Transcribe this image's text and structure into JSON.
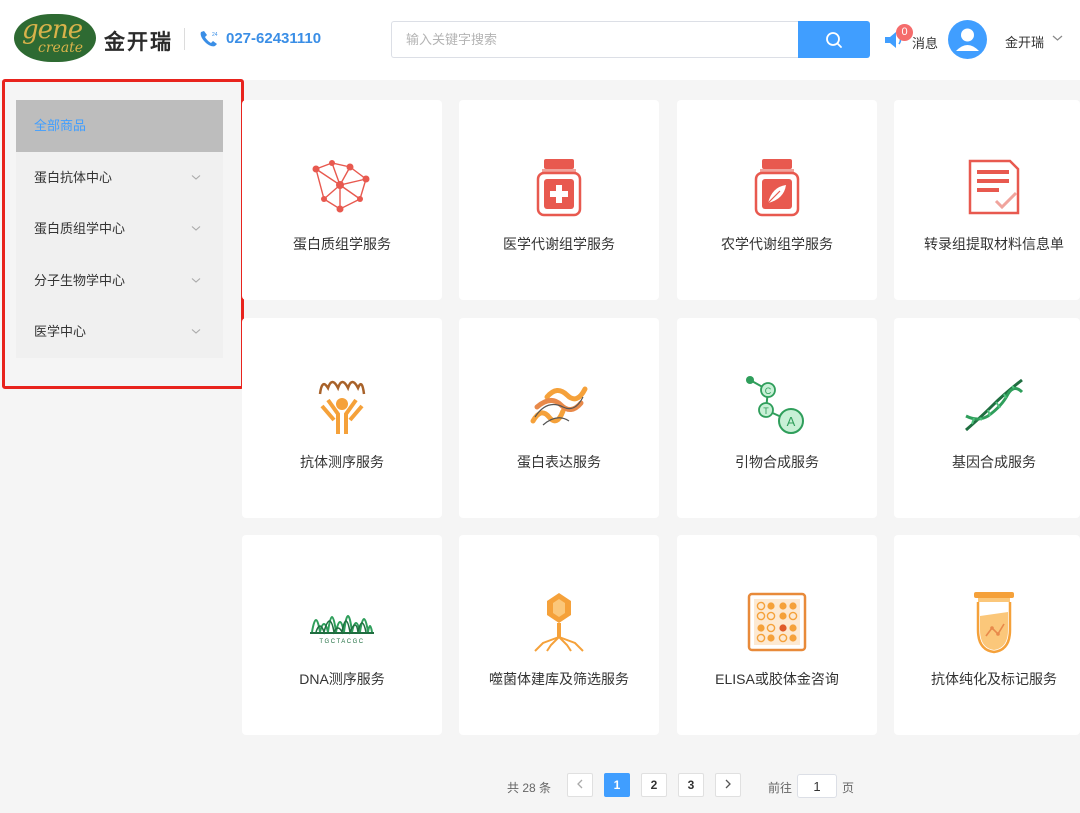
{
  "header": {
    "logo_word_top": "gene",
    "logo_word_bottom": "create",
    "brand": "金开瑞",
    "phone": "027-62431110",
    "search_placeholder": "输入关键字搜索",
    "message_count": "0",
    "message_label": "消息",
    "username": "金开瑞"
  },
  "sidebar": {
    "items": [
      {
        "label": "全部商品",
        "active": true
      },
      {
        "label": "蛋白抗体中心"
      },
      {
        "label": "蛋白质组学中心"
      },
      {
        "label": "分子生物学中心"
      },
      {
        "label": "医学中心"
      }
    ]
  },
  "products": [
    {
      "title": "蛋白质组学服务",
      "icon": "protein-network-icon"
    },
    {
      "title": "医学代谢组学服务",
      "icon": "medicine-bottle-icon"
    },
    {
      "title": "农学代谢组学服务",
      "icon": "agri-bottle-icon"
    },
    {
      "title": "转录组提取材料信息单",
      "icon": "document-form-icon"
    },
    {
      "title": "抗体测序服务",
      "icon": "antibody-icon"
    },
    {
      "title": "蛋白表达服务",
      "icon": "protein-structure-icon"
    },
    {
      "title": "引物合成服务",
      "icon": "primer-chain-icon"
    },
    {
      "title": "基因合成服务",
      "icon": "dna-helix-icon"
    },
    {
      "title": "DNA测序服务",
      "icon": "sequencing-peaks-icon"
    },
    {
      "title": "噬菌体建库及筛选服务",
      "icon": "phage-icon"
    },
    {
      "title": "ELISA或胶体金咨询",
      "icon": "elisa-plate-icon"
    },
    {
      "title": "抗体纯化及标记服务",
      "icon": "test-tube-icon"
    }
  ],
  "sequencing_label": "TGCTACGC",
  "pagination": {
    "total": "共 28 条",
    "pages": [
      "1",
      "2",
      "3"
    ],
    "current": "1",
    "goto_label": "前往",
    "goto_value": "1",
    "goto_suffix": "页"
  },
  "colors": {
    "accent": "#409eff",
    "icon_red": "#e8594f",
    "icon_orange": "#f5a13a",
    "icon_green": "#2f9e5b",
    "highlight_outline": "#e8231d"
  }
}
